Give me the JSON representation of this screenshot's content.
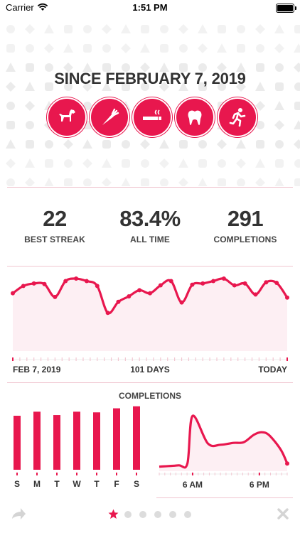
{
  "status_bar": {
    "carrier": "Carrier",
    "time": "1:51 PM"
  },
  "header": {
    "title": "SINCE FEBRUARY 7, 2019"
  },
  "habit_icons": [
    "dog-icon",
    "carrot-icon",
    "cigarette-icon",
    "tooth-icon",
    "running-icon"
  ],
  "accent_color": "#e8174e",
  "stats": [
    {
      "value": "22",
      "label": "BEST STREAK"
    },
    {
      "value": "83.4%",
      "label": "ALL TIME"
    },
    {
      "value": "291",
      "label": "COMPLETIONS"
    }
  ],
  "trend": {
    "start_label": "FEB 7, 2019",
    "middle_label": "101 DAYS",
    "end_label": "TODAY"
  },
  "completions": {
    "title": "COMPLETIONS",
    "weekday_labels": [
      "S",
      "M",
      "T",
      "W",
      "T",
      "F",
      "S"
    ],
    "weekday_values": [
      0.8,
      0.86,
      0.81,
      0.86,
      0.85,
      0.91,
      0.94
    ],
    "time_labels": [
      "6 AM",
      "6 PM"
    ]
  },
  "footer": {
    "page_dots": 6,
    "active_index": 0
  }
}
